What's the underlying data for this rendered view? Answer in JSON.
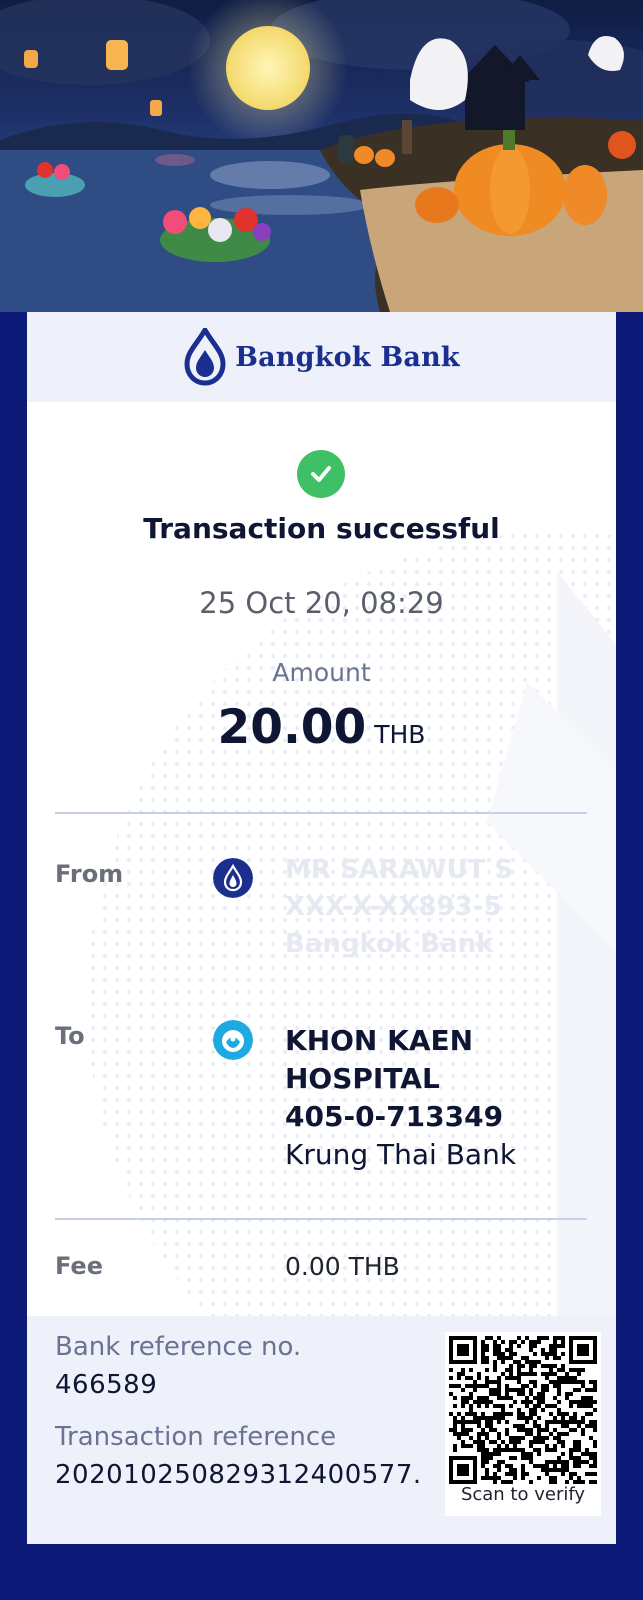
{
  "bank": {
    "name": "Bangkok Bank"
  },
  "status": {
    "title": "Transaction successful",
    "icon": "check-icon",
    "color": "#3fc066"
  },
  "datetime": "25 Oct 20, 08:29",
  "amount": {
    "label": "Amount",
    "value": "20.00",
    "currency": "THB"
  },
  "from": {
    "label": "From",
    "icon": "bangkok-bank-logo-icon",
    "lines": [
      "MR SARAWUT S",
      "XXX-X-XX893-5",
      "Bangkok Bank"
    ]
  },
  "to": {
    "label": "To",
    "icon": "krungthai-bank-logo-icon",
    "name_line1": "KHON KAEN",
    "name_line2": "HOSPITAL",
    "account": "405-0-713349",
    "bank": "Krung Thai Bank"
  },
  "fee": {
    "label": "Fee",
    "value": "0.00 THB"
  },
  "references": {
    "bank_ref_label": "Bank reference no.",
    "bank_ref_value": "466589",
    "txn_ref_label": "Transaction reference",
    "txn_ref_value": "2020102508293124005​77."
  },
  "qr": {
    "caption": "Scan to verify"
  },
  "colors": {
    "brand": "#1b2f8f",
    "background": "#0d1a78",
    "success": "#3fc066"
  }
}
